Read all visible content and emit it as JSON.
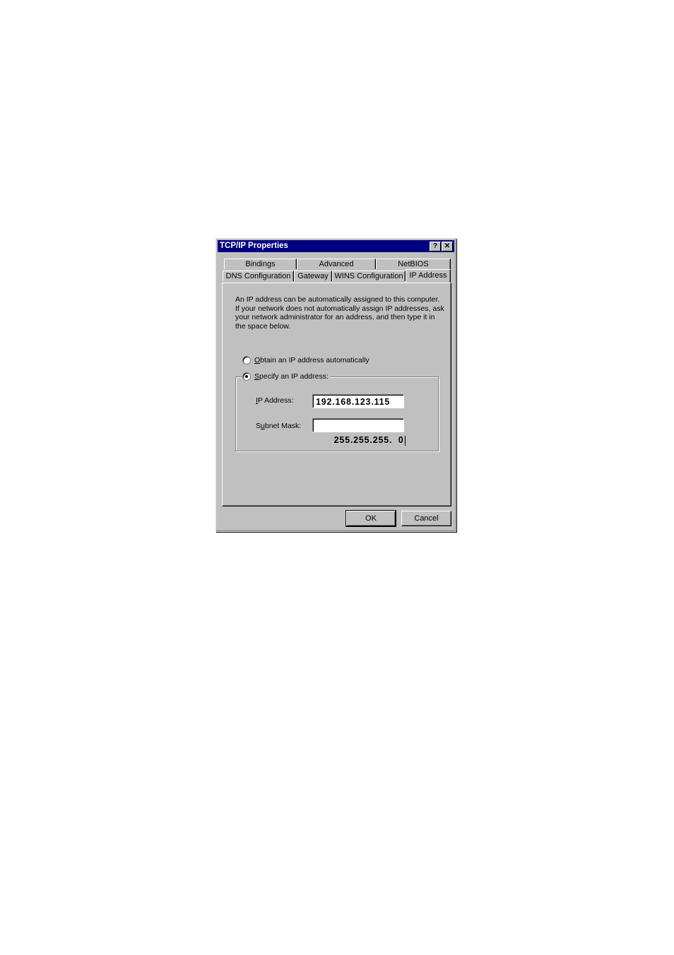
{
  "dialog": {
    "title": "TCP/IP Properties",
    "help_button": "?",
    "close_button": "✕"
  },
  "tabs": {
    "row1": [
      {
        "label": "Bindings"
      },
      {
        "label": "Advanced"
      },
      {
        "label": "NetBIOS"
      }
    ],
    "row2": [
      {
        "label": "DNS Configuration"
      },
      {
        "label": "Gateway"
      },
      {
        "label": "WINS Configuration"
      },
      {
        "label": "IP Address",
        "active": true
      }
    ]
  },
  "panel": {
    "description_lines": [
      "An IP address can be automatically assigned to this computer.",
      "If your network does not automatically assign IP addresses, ask",
      "your network administrator for an address, and then type it in",
      "the space below."
    ],
    "radio_obtain": {
      "mnemonic": "O",
      "rest": "btain an IP address automatically",
      "checked": false
    },
    "radio_specify": {
      "mnemonic": "S",
      "rest": "pecify an IP address:",
      "checked": true
    },
    "ip_label": {
      "mnemonic": "I",
      "rest": "P Address:"
    },
    "ip_value": "192.168.123.115",
    "subnet_label": {
      "pre": "S",
      "mnemonic": "u",
      "rest": "bnet Mask:"
    },
    "subnet_value": "255.255.255.  0"
  },
  "buttons": {
    "ok": "OK",
    "cancel": "Cancel"
  }
}
